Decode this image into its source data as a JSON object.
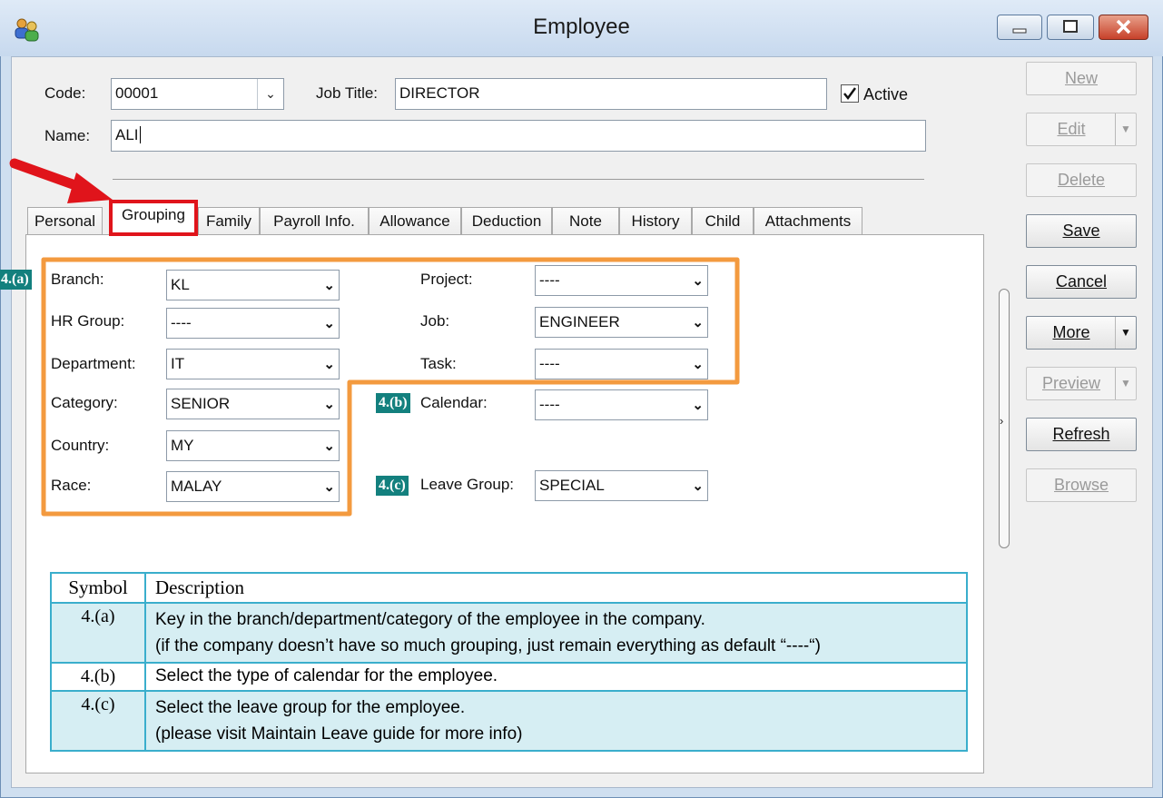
{
  "window": {
    "title": "Employee"
  },
  "form": {
    "code_label": "Code:",
    "code_value": "00001",
    "jobtitle_label": "Job Title:",
    "jobtitle_value": "DIRECTOR",
    "active_label": "Active",
    "active_checked": true,
    "name_label": "Name:",
    "name_value": "ALI"
  },
  "actions": [
    {
      "label": "New",
      "enabled": false
    },
    {
      "label": "Edit",
      "enabled": false,
      "split": true
    },
    {
      "label": "Delete",
      "enabled": false
    },
    {
      "label": "Save",
      "enabled": true
    },
    {
      "label": "Cancel",
      "enabled": true
    },
    {
      "label": "More",
      "enabled": true,
      "split": true
    },
    {
      "label": "Preview",
      "enabled": false,
      "split": true
    },
    {
      "label": "Refresh",
      "enabled": true
    },
    {
      "label": "Browse",
      "enabled": false
    }
  ],
  "tabs": [
    "Personal",
    "Grouping",
    "Family",
    "Payroll Info.",
    "Allowance",
    "Deduction",
    "Note",
    "History",
    "Child",
    "Attachments"
  ],
  "active_tab": "Grouping",
  "grouping": {
    "branch_label": "Branch:",
    "branch_value": "KL",
    "hrgroup_label": "HR Group:",
    "hrgroup_value": "----",
    "department_label": "Department:",
    "department_value": "IT",
    "category_label": "Category:",
    "category_value": "SENIOR",
    "country_label": "Country:",
    "country_value": "MY",
    "race_label": "Race:",
    "race_value": "MALAY",
    "project_label": "Project:",
    "project_value": "----",
    "job_label": "Job:",
    "job_value": "ENGINEER",
    "task_label": "Task:",
    "task_value": "----",
    "calendar_label": "Calendar:",
    "calendar_value": "----",
    "leavegroup_label": "Leave Group:",
    "leavegroup_value": "SPECIAL"
  },
  "badges": {
    "a": "4.(a)",
    "b": "4.(b)",
    "c": "4.(c)"
  },
  "legend": {
    "header_symbol": "Symbol",
    "header_description": "Description",
    "rows": [
      {
        "symbol": "4.(a)",
        "line1": "Key in the branch/department/category of the employee in the company.",
        "line2": "(if the company doesn’t have so much grouping, just remain everything as default “----“)"
      },
      {
        "symbol": "4.(b)",
        "line1": "Select the type of calendar for the employee.",
        "line2": ""
      },
      {
        "symbol": "4.(c)",
        "line1": "Select the leave group for the employee.",
        "line2": "(please visit Maintain Leave guide for more info)"
      }
    ]
  },
  "colors": {
    "highlight_orange": "#f39a3f",
    "tab_highlight_red": "#e0141b",
    "badge_teal": "#13807e",
    "legend_row_fill": "#d6eef3",
    "legend_border": "#3aaecc"
  }
}
